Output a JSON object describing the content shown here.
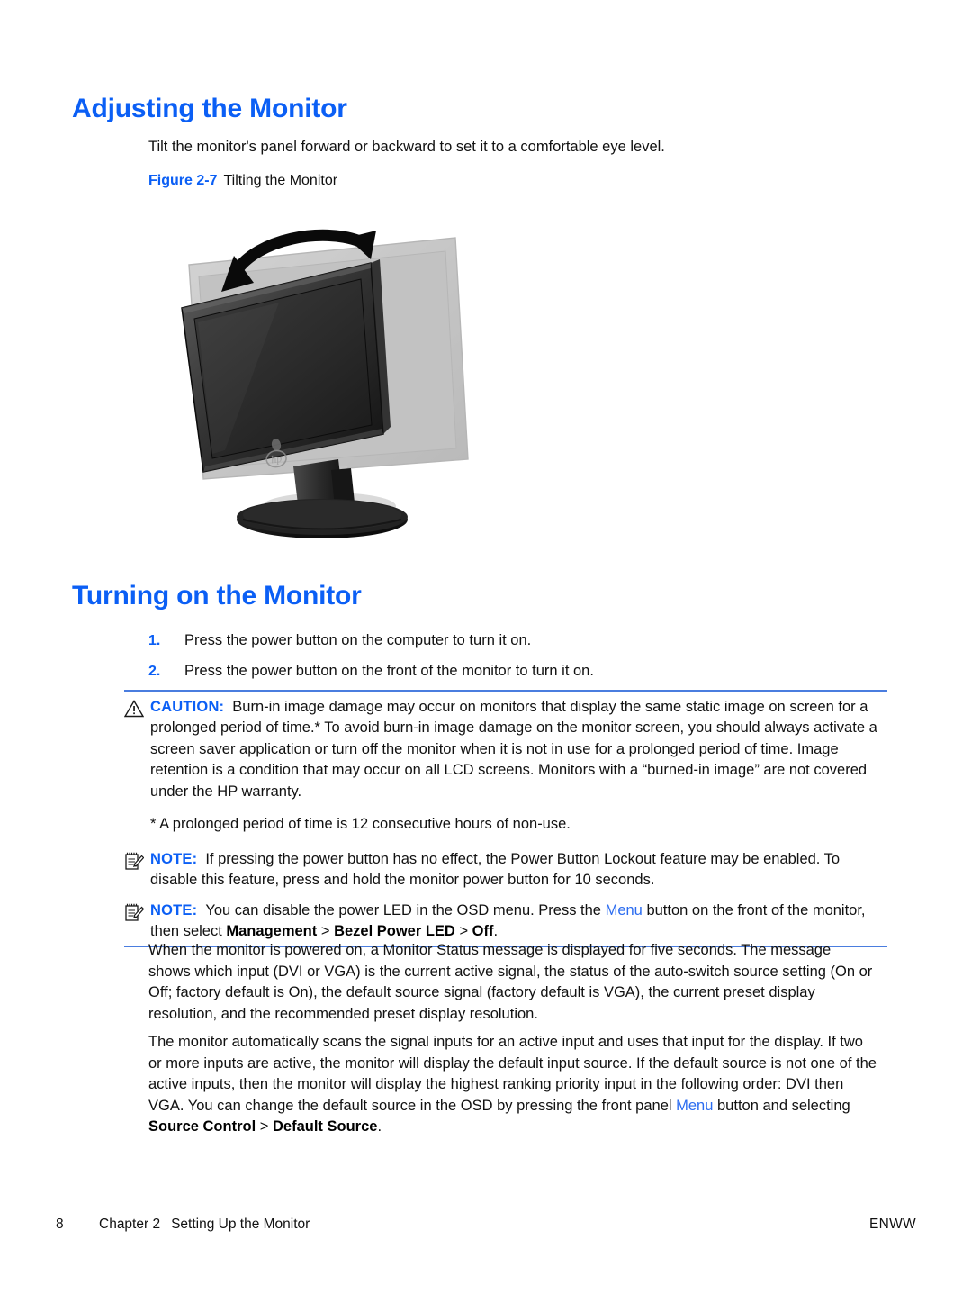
{
  "document": {
    "type": "hp-monitor-user-guide-page",
    "accent_color": "#0b5ff5",
    "rule_color": "#4a7ddf",
    "link_color": "#2b6cf0"
  },
  "headings": {
    "adjusting": "Adjusting the Monitor",
    "turning_on": "Turning on the Monitor"
  },
  "intro": {
    "paragraph": "Tilt the monitor's panel forward or backward to set it to a comfortable eye level."
  },
  "figure": {
    "label": "Figure 2-7",
    "title": "Tilting the Monitor",
    "alt": "Line illustration of an HP flat-panel monitor on a stand, shown tilted with a translucent ghost image of an alternate tilt position and a curved double-headed arrow above indicating the tilt motion.",
    "brand_logo": "hp"
  },
  "steps": [
    {
      "number": "1.",
      "text": "Press the power button on the computer to turn it on."
    },
    {
      "number": "2.",
      "text": "Press the power button on the front of the monitor to turn it on."
    }
  ],
  "admonitions": {
    "caution": {
      "icon": "warning-triangle-icon",
      "keyword": "CAUTION:",
      "text": "Burn-in image damage may occur on monitors that display the same static image on screen for a prolonged period of time.* To avoid burn-in image damage on the monitor screen, you should always activate a screen saver application or turn off the monitor when it is not in use for a prolonged period of time. Image retention is a condition that may occur on all LCD screens. Monitors with a “burned-in image” are not covered under the HP warranty."
    },
    "footnote": "* A prolonged period of time is 12 consecutive hours of non-use.",
    "note_one": {
      "icon": "notepad-pencil-icon",
      "keyword": "NOTE:",
      "text": "If pressing the power button has no effect, the Power Button Lockout feature may be enabled. To disable this feature, press and hold the monitor power button for 10 seconds."
    },
    "note_two": {
      "icon": "notepad-pencil-icon",
      "keyword": "NOTE:",
      "text_part1": "You can disable the power LED in the OSD menu. Press the ",
      "link": "Menu",
      "text_part2": " button on the front of the monitor, then select ",
      "bold1": "Management",
      "sep1": " > ",
      "bold2": "Bezel Power LED",
      "sep2": " > ",
      "bold3": "Off",
      "text_part3": "."
    }
  },
  "paragraphs": {
    "monitor_status": "When the monitor is powered on, a Monitor Status message is displayed for five seconds. The message shows which input (DVI or VGA) is the current active signal, the status of the auto-switch source setting (On or Off; factory default is On), the default source signal (factory default is VGA), the current preset display resolution, and the recommended preset display resolution.",
    "auto_scan": {
      "part1": "The monitor automatically scans the signal inputs for an active input and uses that input for the display. If two or more inputs are active, the monitor will display the default input source. If the default source is not one of the active inputs, then the monitor will display the highest ranking priority input in the following order: DVI then VGA. You can change the default source in the OSD by pressing the front panel ",
      "link": "Menu",
      "part2": " button and selecting ",
      "bold1": "Source Control",
      "sep1": " > ",
      "bold2": "Default Source",
      "part3": "."
    }
  },
  "footer": {
    "page_number": "8",
    "chapter": "Chapter 2",
    "chapter_title": "Setting Up the Monitor",
    "locale": "ENWW"
  }
}
